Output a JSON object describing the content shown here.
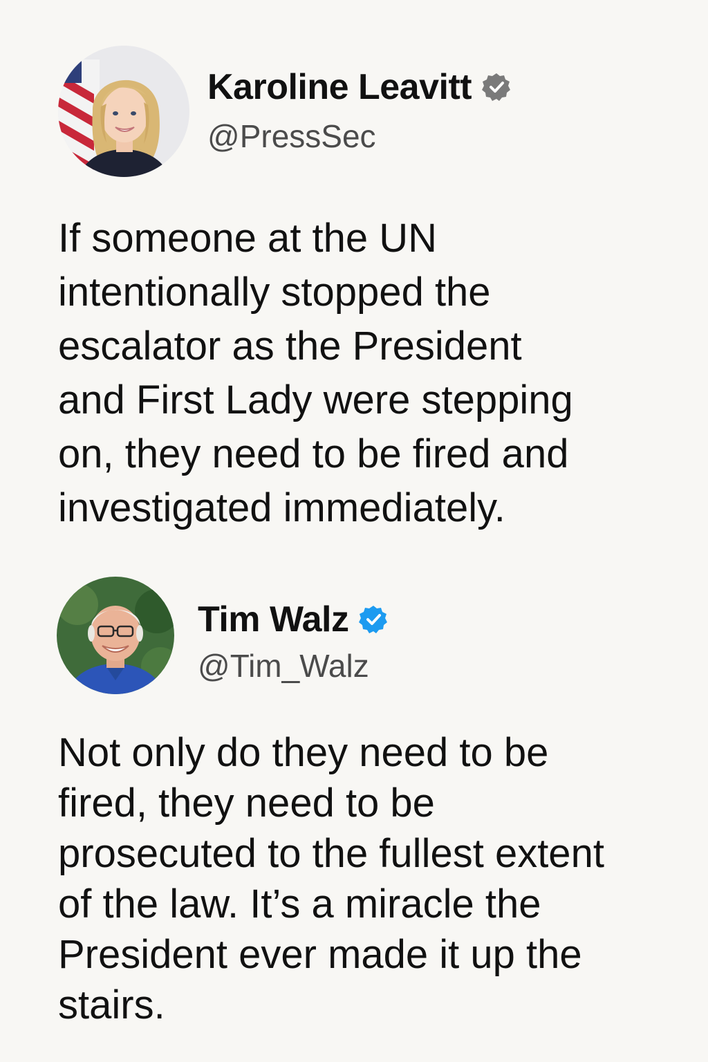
{
  "tweets": [
    {
      "display_name": "Karoline Leavitt",
      "handle": "@PressSec",
      "verified_badge_color": "#7a7a7a",
      "avatar_icon": "profile-photo-woman-flag",
      "text_lines": [
        "If someone at the UN",
        "intentionally stopped the",
        "escalator as the President",
        "and First Lady were stepping",
        "on, they need to be fired and",
        "investigated immediately."
      ]
    },
    {
      "display_name": "Tim Walz",
      "handle": "@Tim_Walz",
      "verified_badge_color": "#1d9bf0",
      "avatar_icon": "profile-photo-man-glasses",
      "text_lines": [
        "Not only do they need to be",
        "fired, they need to be",
        "prosecuted to the fullest extent",
        "of the law. It’s a miracle the",
        "President ever made it up the",
        "stairs."
      ]
    }
  ],
  "colors": {
    "background": "#f8f7f4",
    "text": "#111111",
    "handle_text": "#4b4b4b"
  }
}
